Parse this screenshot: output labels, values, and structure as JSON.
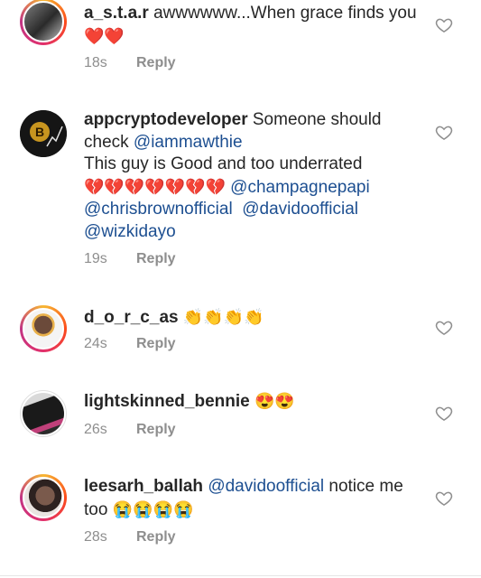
{
  "comments": [
    {
      "username": "a_s.t.a.r",
      "text_parts": [
        " awwwwww...When grace finds you"
      ],
      "emojis": "❤️❤️",
      "time": "18s",
      "reply": "Reply"
    },
    {
      "username": "appcryptodeveloper",
      "line1": " Someone should check ",
      "mention1": "@iammawthie",
      "line2": "This guy is Good and too underrated",
      "emojis": "💔💔💔💔💔💔💔",
      "mention2": "@champagnepapi",
      "mention3": "@chrisbrownofficial",
      "mention4": "@davidoofficial",
      "mention5": "@wizkidayo",
      "time": "19s",
      "reply": "Reply"
    },
    {
      "username": "d_o_r_c_as",
      "emojis": "👏👏👏👏",
      "time": "24s",
      "reply": "Reply"
    },
    {
      "username": "lightskinned_bennie",
      "emojis": "😍😍",
      "time": "26s",
      "reply": "Reply"
    },
    {
      "username": "leesarh_ballah",
      "mention": "@davidoofficial",
      "text": " notice me too ",
      "emojis": "😭😭😭😭",
      "time": "28s",
      "reply": "Reply"
    }
  ],
  "colors": {
    "text": "#262626",
    "mention": "#1d4f91",
    "meta": "#8e8e8e"
  },
  "icons": {
    "like": "heart-outline-icon"
  }
}
